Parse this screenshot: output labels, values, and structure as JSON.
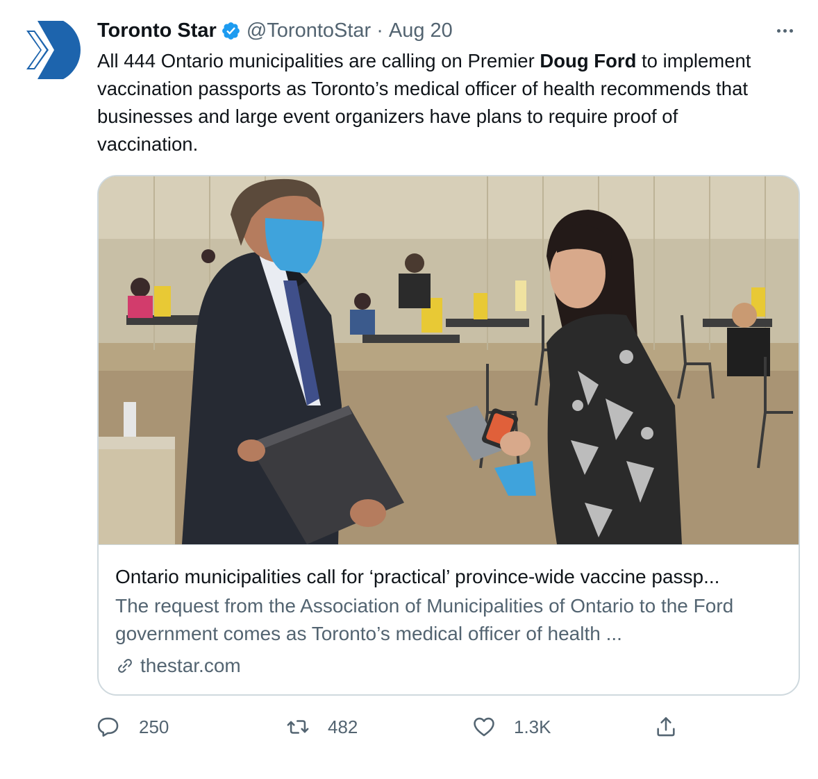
{
  "tweet": {
    "display_name": "Toronto Star",
    "handle": "@TorontoStar",
    "separator": "·",
    "date": "Aug 20",
    "text_before": "All 444 Ontario municipalities are calling on Premier ",
    "text_bold": "Doug Ford",
    "text_after": " to implement vaccination passports as Toronto’s medical officer of health recommends that businesses and large event organizers have plans to require proof of vaccination."
  },
  "card": {
    "title": "Ontario municipalities call for ‘practical’ province-wide vaccine passp...",
    "description": "The request from the Association of Municipalities of Ontario to the Ford government comes as Toronto’s medical officer of health ...",
    "domain": "thestar.com",
    "image_alt": "Doug Ford wearing a blue #GiveBlue mask speaks with a woman at a vaccination clinic"
  },
  "actions": {
    "replies": "250",
    "retweets": "482",
    "likes": "1.3K"
  },
  "icons": {
    "avatar": "toronto-star-logo",
    "verified": "verified-badge-icon",
    "more": "more-options-icon",
    "link": "link-icon",
    "reply": "reply-icon",
    "retweet": "retweet-icon",
    "like": "heart-icon",
    "share": "share-icon"
  },
  "colors": {
    "brand_blue": "#1d64ad",
    "verified_blue": "#1d9bf0",
    "text_primary": "#0f1419",
    "text_secondary": "#536471",
    "border": "#cfd9de"
  }
}
